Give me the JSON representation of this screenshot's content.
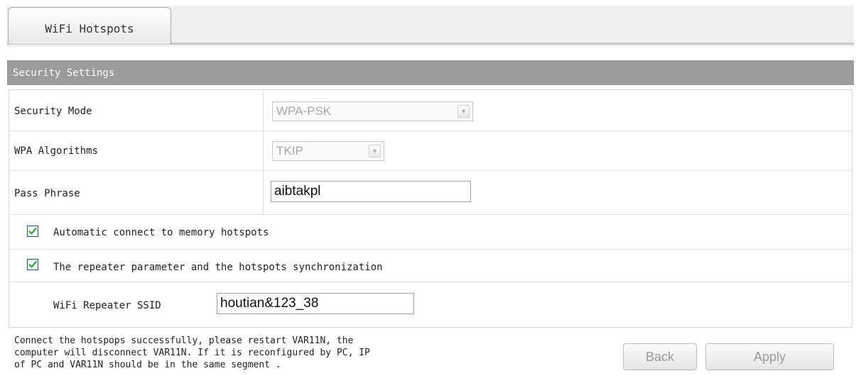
{
  "tabs": [
    {
      "label": "WiFi Hotspots"
    }
  ],
  "section": {
    "title": "Security Settings"
  },
  "form": {
    "security_mode": {
      "label": "Security Mode",
      "value": "WPA-PSK"
    },
    "wpa_algorithms": {
      "label": "WPA Algorithms",
      "value": "TKIP"
    },
    "pass_phrase": {
      "label": "Pass Phrase",
      "value": "aibtakpl"
    },
    "auto_connect": {
      "label": "Automatic connect to memory hotspots",
      "checked": true
    },
    "repeater_sync": {
      "label": "The repeater parameter and the hotspots synchronization",
      "checked": true
    },
    "repeater_ssid": {
      "label": "WiFi Repeater SSID",
      "value": "houtian&123_38"
    }
  },
  "notice": "Connect the hotspops successfully, please restart VAR11N, the\ncomputer will disconnect VAR11N. If it is reconfigured by PC, IP\nof PC and VAR11N should be in the same segment .",
  "buttons": {
    "back": "Back",
    "apply": "Apply"
  },
  "colors": {
    "header_bg": "#9b9b9b",
    "check": "#21a121"
  }
}
